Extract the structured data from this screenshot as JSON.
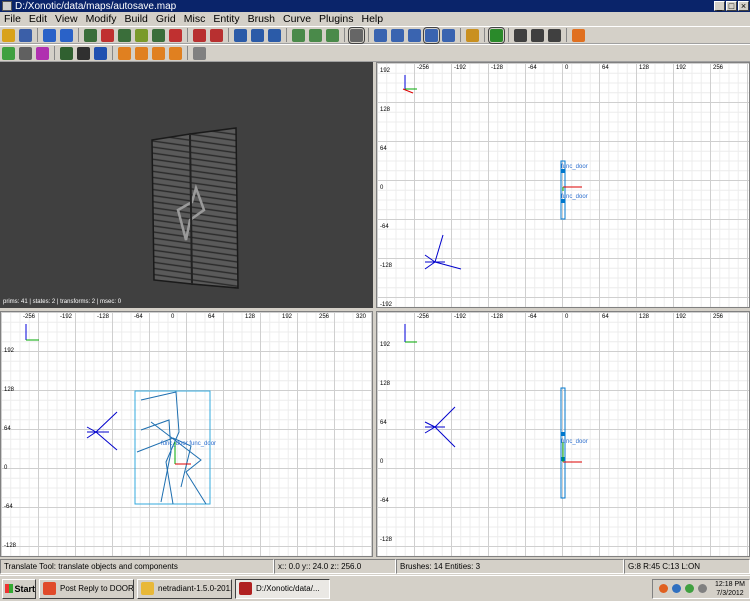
{
  "window": {
    "title": "D:/Xonotic/data/maps/autosave.map",
    "minimize_label": "_",
    "maximize_label": "□",
    "close_label": "×"
  },
  "menu": [
    "File",
    "Edit",
    "View",
    "Modify",
    "Build",
    "Grid",
    "Misc",
    "Entity",
    "Brush",
    "Curve",
    "Plugins",
    "Help"
  ],
  "toolbar1": [
    {
      "name": "open-icon",
      "color": "#d8a21a"
    },
    {
      "name": "save-icon",
      "color": "#3b5fa8"
    },
    {
      "sep": true
    },
    {
      "name": "undo-icon",
      "color": "#2a62c8"
    },
    {
      "name": "redo-icon",
      "color": "#2a62c8"
    },
    {
      "sep": true
    },
    {
      "name": "flip-x-icon",
      "color": "#3a6e3a"
    },
    {
      "name": "rotate-x-icon",
      "color": "#c03030"
    },
    {
      "name": "flip-y-icon",
      "color": "#3a6e3a"
    },
    {
      "name": "rotate-y-icon",
      "color": "#7a9a2a"
    },
    {
      "name": "flip-z-icon",
      "color": "#3a6e3a"
    },
    {
      "name": "rotate-z-icon",
      "color": "#c03030"
    },
    {
      "sep": true
    },
    {
      "name": "select-complete-tall-icon",
      "color": "#b83030"
    },
    {
      "name": "select-touching-icon",
      "color": "#b83030"
    },
    {
      "sep": true
    },
    {
      "name": "select-inside-icon",
      "color": "#2b5ba8"
    },
    {
      "name": "select-partial-tall-icon",
      "color": "#2b5ba8"
    },
    {
      "name": "select-touch-icon",
      "color": "#2b5ba8"
    },
    {
      "sep": true
    },
    {
      "name": "csg-subtract-icon",
      "color": "#4a8a4a"
    },
    {
      "name": "csg-merge-icon",
      "color": "#4a8a4a"
    },
    {
      "name": "csg-hollow-icon",
      "color": "#4a8a4a"
    },
    {
      "sep": true
    },
    {
      "name": "clipper-icon",
      "color": "#666666",
      "active": true
    },
    {
      "sep": true
    },
    {
      "name": "translate-icon",
      "color": "#3a64b0"
    },
    {
      "name": "rotate-icon",
      "color": "#3a64b0"
    },
    {
      "name": "scale-icon",
      "color": "#3a64b0"
    },
    {
      "name": "drag-icon",
      "color": "#3a64b0",
      "active": true
    },
    {
      "name": "resize-icon",
      "color": "#3a64b0"
    },
    {
      "sep": true
    },
    {
      "name": "camera-icon",
      "color": "#c99020"
    },
    {
      "sep": true
    },
    {
      "name": "texture-lock-icon",
      "color": "#2a8a2a",
      "active": true
    },
    {
      "sep": true
    },
    {
      "name": "view-xy-icon",
      "color": "#404040"
    },
    {
      "name": "view-xz-icon",
      "color": "#404040"
    },
    {
      "name": "view-yz-icon",
      "color": "#404040"
    },
    {
      "sep": true
    },
    {
      "name": "shader-icon",
      "color": "#e07020"
    }
  ],
  "toolbar2": [
    {
      "name": "patch-icon",
      "color": "#40a040"
    },
    {
      "name": "patch-cone-icon",
      "color": "#606060"
    },
    {
      "name": "patch-cap-icon",
      "color": "#b030b0"
    },
    {
      "sep": true
    },
    {
      "name": "filter-icon",
      "color": "#306030"
    },
    {
      "name": "filter-detail-icon",
      "color": "#303030"
    },
    {
      "name": "filter-hint-icon",
      "color": "#2050b0"
    },
    {
      "sep": true
    },
    {
      "name": "entity-icon-1",
      "color": "#e08020"
    },
    {
      "name": "entity-icon-2",
      "color": "#e08020"
    },
    {
      "name": "entity-icon-3",
      "color": "#e08020"
    },
    {
      "name": "entity-icon-4",
      "color": "#e08020"
    },
    {
      "sep": true
    },
    {
      "name": "grid-toggle-icon",
      "color": "#808080"
    }
  ],
  "viewport3d": {
    "stats": "prims: 41 | states: 2 | transforms: 2 | msec: 0"
  },
  "xy_view": {
    "x_ticks": [
      "-256",
      "-192",
      "-128",
      "-64",
      "0",
      "64",
      "128",
      "192",
      "256"
    ],
    "y_ticks": [
      "192",
      "128",
      "64",
      "0",
      "-64",
      "-128",
      "-192"
    ],
    "entities": [
      "func_door",
      "func_door"
    ]
  },
  "side_view": {
    "x_ticks": [
      "-256",
      "-192",
      "-128",
      "-64",
      "0",
      "64",
      "128",
      "192",
      "256",
      "320"
    ],
    "y_ticks": [
      "192",
      "128",
      "64",
      "0",
      "-64",
      "-128"
    ],
    "entity": "func_door func_door"
  },
  "front_view": {
    "x_ticks": [
      "-256",
      "-192",
      "-128",
      "-64",
      "0",
      "64",
      "128",
      "192",
      "256"
    ],
    "y_ticks": [
      "192",
      "128",
      "64",
      "0",
      "-64",
      "-128"
    ],
    "entity": "func_door"
  },
  "status": {
    "tool": "Translate Tool: translate objects and components",
    "coords": "x::   0.0  y::   24.0  z::  256.0",
    "counts": "Brushes: 14 Entities: 3",
    "grid": "G:8  R:45  C:13  L:ON"
  },
  "taskbar": {
    "start_label": "Start",
    "tasks": [
      {
        "label": "Post Reply to DOORS...",
        "icon": "#e04a2a"
      },
      {
        "label": "netradiant-1.5.0-201...",
        "icon": "#e8b838"
      },
      {
        "label": "D:/Xonotic/data/...",
        "icon": "#b02020",
        "active": true
      }
    ],
    "clock_time": "12:18 PM",
    "clock_date": "7/3/2012"
  }
}
